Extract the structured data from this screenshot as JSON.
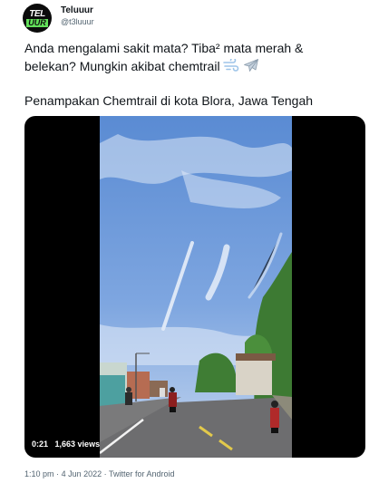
{
  "author": {
    "name": "Teluuur",
    "handle": "@t3luuur",
    "avatar_line1": "TEL",
    "avatar_line2": "UUR"
  },
  "tweet": {
    "line1": "Anda mengalami sakit mata? Tiba² mata merah &",
    "line2": "belekan? Mungkin akibat chemtrail",
    "line2_emojis": [
      "dash-icon",
      "airplane-icon"
    ],
    "line3": "Penampakan Chemtrail di kota Blora, Jawa Tengah"
  },
  "video": {
    "time": "0:21",
    "views": "1,663 views"
  },
  "footer": {
    "time": "1:10 pm",
    "separator1": "·",
    "date": "4 Jun 2022",
    "separator2": "·",
    "source": "Twitter for Android"
  },
  "colors": {
    "sky_top": "#5f8fd6",
    "sky_bottom": "#b7cdee",
    "avatar_bg": "#0b0b0b",
    "avatar_accent": "#62e05a",
    "muted_text": "#536471"
  }
}
